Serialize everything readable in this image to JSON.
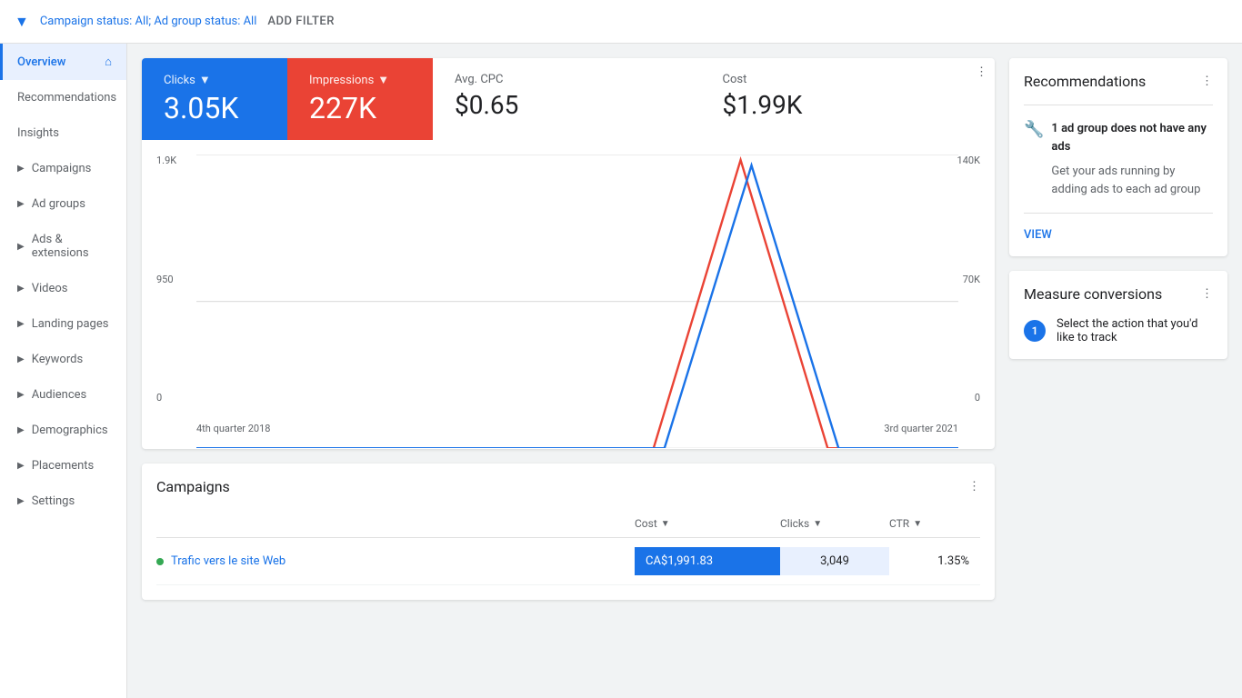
{
  "topbar": {
    "filter_icon": "▼",
    "filter_text": "Campaign status: All; Ad group status: All",
    "add_filter": "ADD FILTER"
  },
  "sidebar": {
    "items": [
      {
        "id": "overview",
        "label": "Overview",
        "active": true,
        "has_home": true,
        "has_arrow": false
      },
      {
        "id": "recommendations",
        "label": "Recommendations",
        "active": false,
        "has_arrow": false,
        "dot": true
      },
      {
        "id": "insights",
        "label": "Insights",
        "active": false,
        "has_arrow": false
      },
      {
        "id": "campaigns",
        "label": "Campaigns",
        "active": false,
        "has_arrow": true
      },
      {
        "id": "ad-groups",
        "label": "Ad groups",
        "active": false,
        "has_arrow": true
      },
      {
        "id": "ads-extensions",
        "label": "Ads & extensions",
        "active": false,
        "has_arrow": true
      },
      {
        "id": "videos",
        "label": "Videos",
        "active": false,
        "has_arrow": true
      },
      {
        "id": "landing-pages",
        "label": "Landing pages",
        "active": false,
        "has_arrow": true
      },
      {
        "id": "keywords",
        "label": "Keywords",
        "active": false,
        "has_arrow": true
      },
      {
        "id": "audiences",
        "label": "Audiences",
        "active": false,
        "has_arrow": true
      },
      {
        "id": "demographics",
        "label": "Demographics",
        "active": false,
        "has_arrow": true
      },
      {
        "id": "placements",
        "label": "Placements",
        "active": false,
        "has_arrow": true
      },
      {
        "id": "settings",
        "label": "Settings",
        "active": false,
        "has_arrow": true
      }
    ]
  },
  "stats": {
    "clicks_label": "Clicks",
    "clicks_value": "3.05K",
    "impressions_label": "Impressions",
    "impressions_value": "227K",
    "avg_cpc_label": "Avg. CPC",
    "avg_cpc_value": "$0.65",
    "cost_label": "Cost",
    "cost_value": "$1.99K",
    "menu_dots": "⋮"
  },
  "chart": {
    "y_left": [
      "1.9K",
      "950",
      "0"
    ],
    "y_right": [
      "140K",
      "70K",
      "0"
    ],
    "x_labels": [
      "4th quarter 2018",
      "3rd quarter 2021"
    ]
  },
  "campaigns_card": {
    "title": "Campaigns",
    "menu_dots": "⋮",
    "columns": {
      "cost": "Cost",
      "clicks": "Clicks",
      "ctr": "CTR"
    },
    "rows": [
      {
        "name": "Trafic vers le site Web",
        "cost": "CA$1,991.83",
        "clicks": "3,049",
        "ctr": "1.35%",
        "status": "active"
      }
    ]
  },
  "recommendations": {
    "title": "Recommendations",
    "menu_dots": "⋮",
    "icon": "🔧",
    "alert_bold": "1 ad group does not have any ads",
    "alert_desc": "Get your ads running by adding ads to each ad group",
    "view_label": "VIEW"
  },
  "measure_conversions": {
    "title": "Measure conversions",
    "menu_dots": "⋮",
    "step1": "Select the action that you'd like to track"
  }
}
